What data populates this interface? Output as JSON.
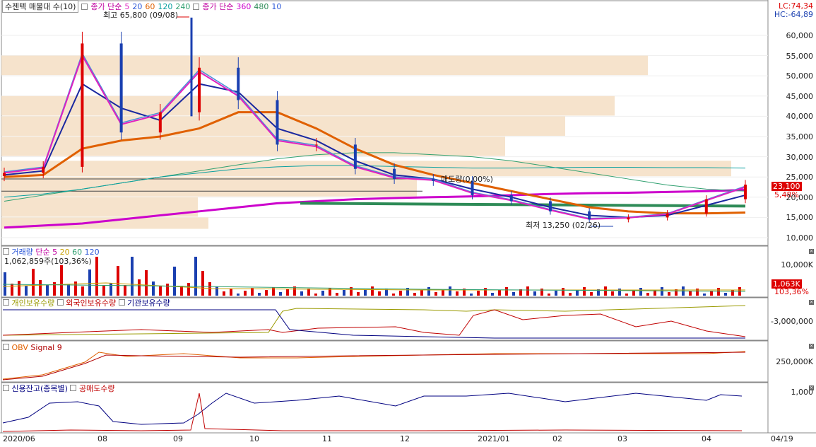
{
  "app": {
    "stock_name": "수젠텍 매물대 수(10)"
  },
  "main_legend": {
    "price_ma_label": "종가 단순",
    "price_ma_periods": [
      "5",
      "20",
      "60",
      "120",
      "240"
    ],
    "price_ma_colors": [
      "#e020c0",
      "#2a56d8",
      "#e06000",
      "#0aa0a0",
      "#30a070"
    ],
    "vol_ma_label": "종가 단순",
    "vol_ma_periods": [
      "360",
      "480",
      "10"
    ],
    "vol_ma_colors": [
      "#cc00cc",
      "#2e8b57",
      "#2a56d8"
    ]
  },
  "top_right": {
    "lc": "LC:74,34",
    "hc": "HC:-64,89"
  },
  "annotations": {
    "high": "최고 65,800 (09/08)",
    "low": "최저 13,250 (02/26)",
    "volume_ratio": "매도량(0,00%)",
    "last_price": "23,100",
    "last_change": "5,48%"
  },
  "price_axis": [
    "60,000",
    "55,000",
    "50,000",
    "45,000",
    "40,000",
    "35,000",
    "30,000",
    "25,000",
    "20,000",
    "15,000",
    "10,000"
  ],
  "volume_panel": {
    "title": "거래량",
    "ma_label": "단순",
    "ma_periods": [
      "5",
      "20",
      "60",
      "120"
    ],
    "value": "1,062,859주(103,36%)",
    "axis": "10,000K",
    "last_box": "1,063K",
    "last_pct": "103,36%"
  },
  "holders_panel": {
    "series": [
      "개인보유수량",
      "외국인보유수량",
      "기관보유수량"
    ],
    "axis": "-3,000,000"
  },
  "obv_panel": {
    "series": [
      "OBV",
      "Signal 9"
    ],
    "axis": "250,000K"
  },
  "credit_panel": {
    "series": [
      "신용잔고(종목별)",
      "공매도수량"
    ],
    "axis": "1,000"
  },
  "dates": [
    "2020/06",
    "08",
    "09",
    "10",
    "11",
    "12",
    "2021/01",
    "02",
    "03",
    "04",
    "04/19"
  ],
  "chart_data": {
    "type": "candlestick",
    "x": [
      "2020/06",
      "2020/07",
      "2020/08",
      "2020/08",
      "2020/09",
      "2020/09",
      "2020/10",
      "2020/10",
      "2020/11",
      "2020/11",
      "2020/12",
      "2020/12",
      "2021/01",
      "2021/01",
      "2021/02",
      "2021/02",
      "2021/03",
      "2021/03",
      "2021/04",
      "2021/04"
    ],
    "close": [
      26000,
      27500,
      58000,
      36000,
      41000,
      52000,
      44000,
      33000,
      33000,
      27000,
      24500,
      24000,
      20500,
      19000,
      16500,
      14500,
      15000,
      16000,
      19500,
      23100
    ],
    "ma": [
      {
        "name": "5",
        "values": [
          26000,
          27200,
          55000,
          38000,
          40500,
          51000,
          45000,
          34000,
          32500,
          27500,
          24800,
          24200,
          21000,
          19200,
          16800,
          14600,
          14900,
          15800,
          19200,
          22500
        ]
      },
      {
        "name": "20",
        "values": [
          25500,
          26500,
          48000,
          42000,
          39000,
          48000,
          46000,
          37000,
          34000,
          29000,
          25500,
          24500,
          22000,
          20000,
          17500,
          15500,
          15000,
          15500,
          18000,
          20500
        ]
      },
      {
        "name": "60",
        "values": [
          25000,
          25500,
          32000,
          34000,
          35000,
          37000,
          41000,
          41000,
          37000,
          32000,
          28000,
          25500,
          23500,
          21500,
          19500,
          17500,
          16500,
          16000,
          16000,
          16200
        ]
      },
      {
        "name": "120",
        "values": [
          20000,
          20800,
          22000,
          23500,
          25000,
          26000,
          27000,
          27500,
          27800,
          27800,
          27600,
          27400,
          27200,
          27200,
          27300,
          27400,
          27400,
          27300,
          27300,
          27200
        ]
      },
      {
        "name": "240",
        "values": [
          19000,
          20500,
          22000,
          23500,
          25000,
          26500,
          28000,
          29500,
          30500,
          31000,
          31000,
          30500,
          30000,
          29000,
          27500,
          26000,
          24500,
          23000,
          22000,
          21500
        ]
      }
    ],
    "price_range": [
      10000,
      65800
    ],
    "high": 65800,
    "low": 13250
  }
}
